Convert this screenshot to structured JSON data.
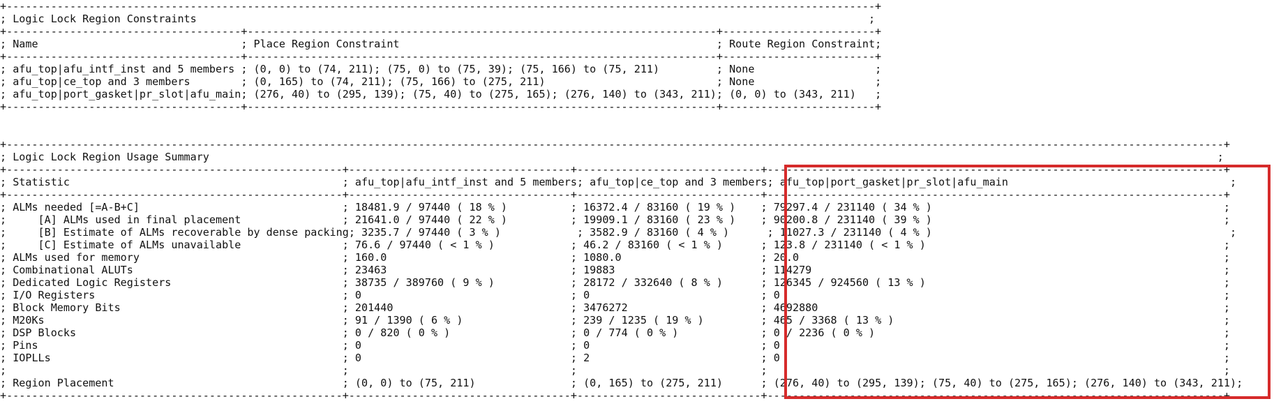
{
  "constraints": {
    "title": "Logic Lock Region Constraints",
    "headers": [
      "Name",
      "Place Region Constraint",
      "Route Region Constraint"
    ],
    "rows": [
      [
        "afu_top|afu_intf_inst and 5 members",
        "(0, 0) to (74, 211); (75, 0) to (75, 39); (75, 166) to (75, 211)",
        "None"
      ],
      [
        "afu_top|ce_top and 3 members",
        "(0, 165) to (74, 211); (75, 166) to (275, 211)",
        "None"
      ],
      [
        "afu_top|port_gasket|pr_slot|afu_main",
        "(276, 40) to (295, 139); (75, 40) to (275, 165); (276, 140) to (343, 211)",
        "(0, 0) to (343, 211)"
      ]
    ]
  },
  "usage": {
    "title": "Logic Lock Region Usage Summary",
    "headers": [
      "Statistic",
      "afu_top|afu_intf_inst and 5 members",
      "afu_top|ce_top and 3 members",
      "afu_top|port_gasket|pr_slot|afu_main"
    ],
    "rows": [
      [
        "ALMs needed [=A-B+C]",
        "18481.9 / 97440 ( 18 % )",
        "16372.4 / 83160 ( 19 % )",
        "79297.4 / 231140 ( 34 % )"
      ],
      [
        "    [A] ALMs used in final placement",
        "21641.0 / 97440 ( 22 % )",
        "19909.1 / 83160 ( 23 % )",
        "90200.8 / 231140 ( 39 % )"
      ],
      [
        "    [B] Estimate of ALMs recoverable by dense packing",
        "3235.7 / 97440 ( 3 % )",
        "3582.9 / 83160 ( 4 % )",
        "11027.3 / 231140 ( 4 % )"
      ],
      [
        "    [C] Estimate of ALMs unavailable",
        "76.6 / 97440 ( < 1 % )",
        "46.2 / 83160 ( < 1 % )",
        "123.8 / 231140 ( < 1 % )"
      ],
      [
        "ALMs used for memory",
        "160.0",
        "1080.0",
        "20.0"
      ],
      [
        "Combinational ALUTs",
        "23463",
        "19883",
        "114279"
      ],
      [
        "Dedicated Logic Registers",
        "38735 / 389760 ( 9 % )",
        "28172 / 332640 ( 8 % )",
        "126345 / 924560 ( 13 % )"
      ],
      [
        "I/O Registers",
        "0",
        "0",
        "0"
      ],
      [
        "Block Memory Bits",
        "201440",
        "3476272",
        "4692880"
      ],
      [
        "M20Ks",
        "91 / 1390 ( 6 % )",
        "239 / 1235 ( 19 % )",
        "465 / 3368 ( 13 % )"
      ],
      [
        "DSP Blocks",
        "0 / 820 ( 0 % )",
        "0 / 774 ( 0 % )",
        "0 / 2236 ( 0 % )"
      ],
      [
        "Pins",
        "0",
        "0",
        "0"
      ],
      [
        "IOPLLs",
        "0",
        "2",
        "0"
      ],
      [
        "",
        "",
        "",
        ""
      ],
      [
        "Region Placement",
        "(0, 0) to (75, 211)",
        "(0, 165) to (275, 211)",
        "(276, 40) to (295, 139); (75, 40) to (275, 165); (276, 140) to (343, 211)"
      ]
    ]
  },
  "colors": {
    "highlight": "#d62b2b",
    "text": "#111111",
    "background": "#ffffff"
  }
}
